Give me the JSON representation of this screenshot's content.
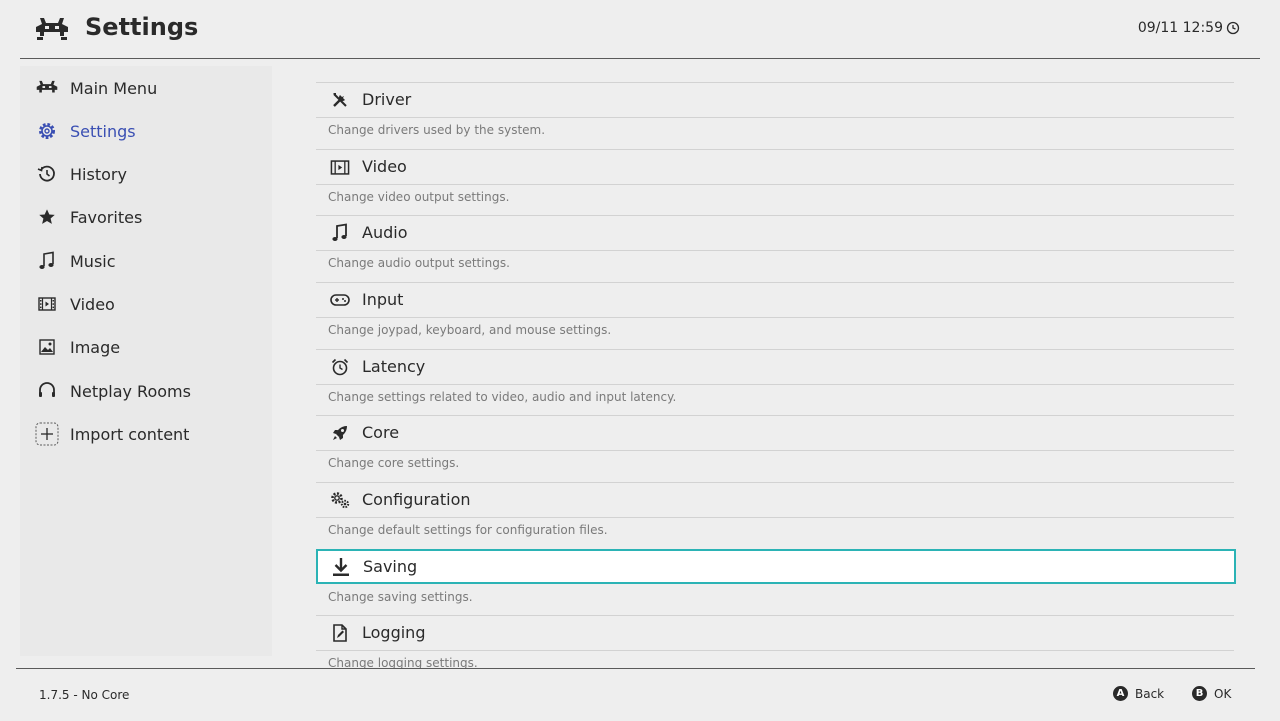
{
  "header": {
    "title": "Settings",
    "clock": "09/11 12:59",
    "logo_icon": "retroarch-invader-icon",
    "clock_icon": "clock-icon"
  },
  "sidebar": {
    "items": [
      {
        "label": "Main Menu",
        "icon": "retroarch-invader-icon"
      },
      {
        "label": "Settings",
        "icon": "gear-icon"
      },
      {
        "label": "History",
        "icon": "history-icon"
      },
      {
        "label": "Favorites",
        "icon": "star-icon"
      },
      {
        "label": "Music",
        "icon": "music-note-icon"
      },
      {
        "label": "Video",
        "icon": "film-icon"
      },
      {
        "label": "Image",
        "icon": "image-icon"
      },
      {
        "label": "Netplay Rooms",
        "icon": "headset-icon"
      },
      {
        "label": "Import content",
        "icon": "plus-box-icon"
      }
    ],
    "active_index": 1
  },
  "entries": [
    {
      "label": "Driver",
      "desc": "Change drivers used by the system.",
      "icon": "tools-icon"
    },
    {
      "label": "Video",
      "desc": "Change video output settings.",
      "icon": "film-icon"
    },
    {
      "label": "Audio",
      "desc": "Change audio output settings.",
      "icon": "music-note-icon"
    },
    {
      "label": "Input",
      "desc": "Change joypad, keyboard, and mouse settings.",
      "icon": "gamepad-icon"
    },
    {
      "label": "Latency",
      "desc": "Change settings related to video, audio and input latency.",
      "icon": "alarm-clock-icon"
    },
    {
      "label": "Core",
      "desc": "Change core settings.",
      "icon": "rocket-icon"
    },
    {
      "label": "Configuration",
      "desc": "Change default settings for configuration files.",
      "icon": "gears-icon"
    },
    {
      "label": "Saving",
      "desc": "Change saving settings.",
      "icon": "download-icon"
    },
    {
      "label": "Logging",
      "desc": "Change logging settings.",
      "icon": "document-icon"
    }
  ],
  "selected_index": 7,
  "footer": {
    "version": "1.7.5 - No Core",
    "back_glyph": "A",
    "back_label": "Back",
    "ok_glyph": "B",
    "ok_label": "OK"
  },
  "colors": {
    "background": "#eeeeee",
    "sidebar": "#e9e9e9",
    "accent_active": "#3a4fb3",
    "selection_border": "#2bb3b5",
    "text": "#2a2a2a",
    "muted": "#7a7a7a"
  }
}
